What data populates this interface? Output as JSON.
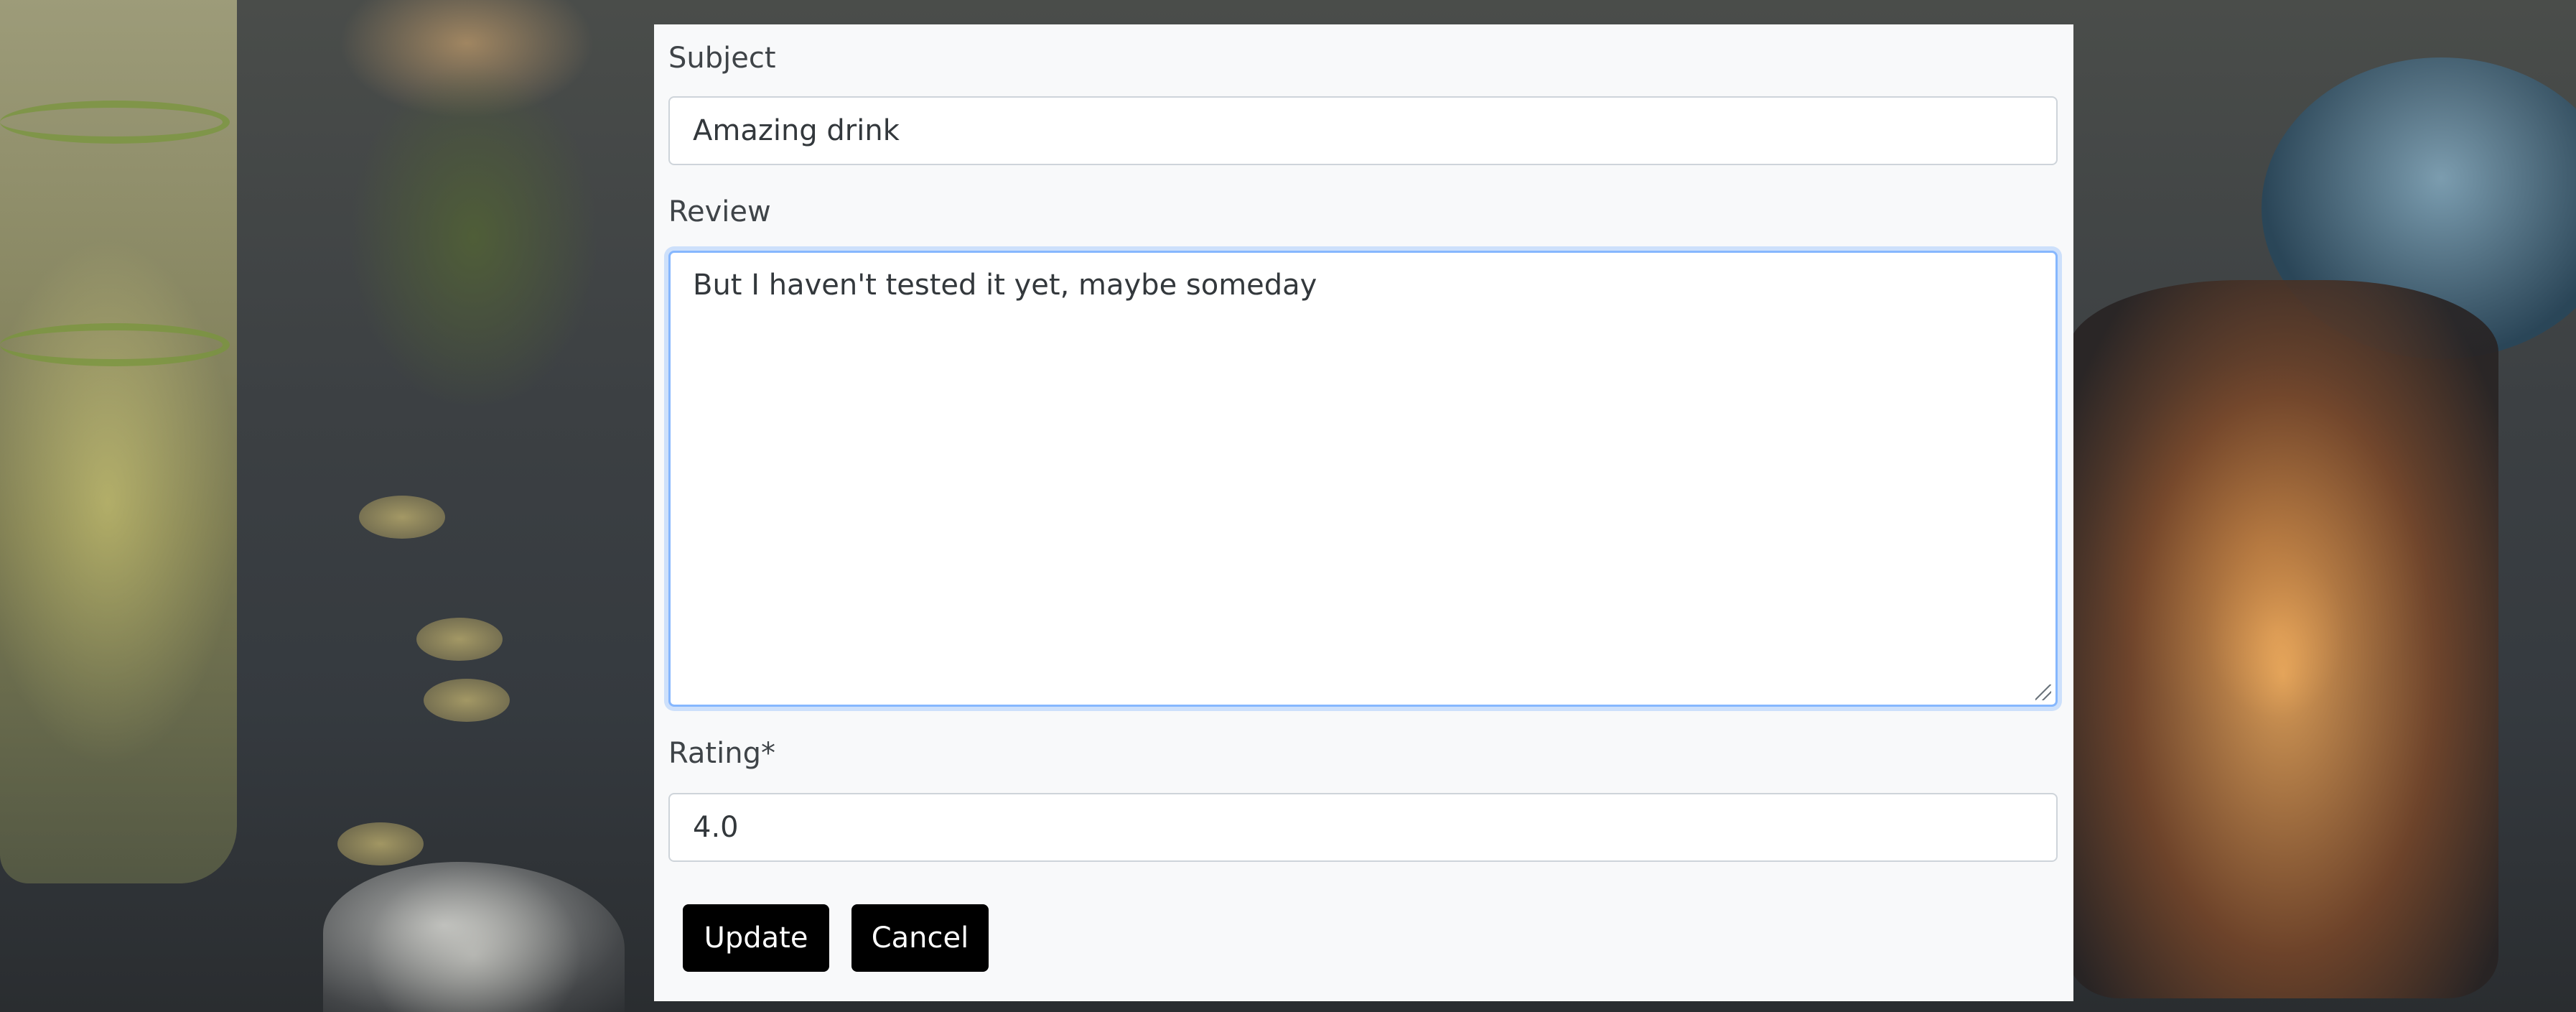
{
  "form": {
    "subject": {
      "label": "Subject",
      "value": "Amazing drink"
    },
    "review": {
      "label": "Review",
      "value": "But I haven't tested it yet, maybe someday"
    },
    "rating": {
      "label": "Rating*",
      "value": "4.0"
    },
    "buttons": {
      "update_label": "Update",
      "cancel_label": "Cancel"
    }
  },
  "colors": {
    "panel_background": "#f8f9fa",
    "button_background": "#000000",
    "button_text": "#ffffff",
    "focus_border": "#86b7fe"
  }
}
